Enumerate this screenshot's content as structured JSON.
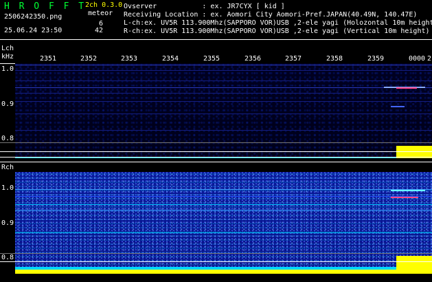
{
  "app": {
    "title": "H R O F F T",
    "mode": "2ch 0.3.0",
    "type_label": "meteor"
  },
  "file": {
    "name": "2506242350.png",
    "datetime": "25.06.24 23:50"
  },
  "counts": {
    "l": "6",
    "r": "42"
  },
  "header": {
    "observer": "Ovserver           : ex. JR7CYX [ kid ]",
    "location": "Receiving Location : ex. Aomori City Aomori-Pref.JAPAN(40.49N, 140.47E)",
    "lch": "L-ch:ex. UV5R 113.900Mhz(SAPPORO VOR)USB ,2-ele yagi (Holozontal 10m height",
    "rch": "R-ch:ex. UV5R 113.900Mhz(SAPPORO VOR)USB ,2-ele yagi (Vertical 10m height)"
  },
  "time_ticks": [
    "2351",
    "2352",
    "2353",
    "2354",
    "2355",
    "2356",
    "2357",
    "2358",
    "2359",
    "0000",
    "2"
  ],
  "lch_panel": {
    "label": "Lch",
    "unit": "kHz",
    "freq_labels": [
      "1.0",
      "0.9",
      "0.8"
    ]
  },
  "rch_panel": {
    "label": "Rch",
    "freq_labels": [
      "1.0",
      "0.9",
      "0.8"
    ]
  },
  "colors": {
    "background": "#000000",
    "title_green": "#00ff33",
    "mode_yellow": "#ffff00",
    "noise_blue": "#0a1a9a",
    "floor_cyan": "#00d8ff",
    "meteor_yellow": "#ffff00"
  }
}
